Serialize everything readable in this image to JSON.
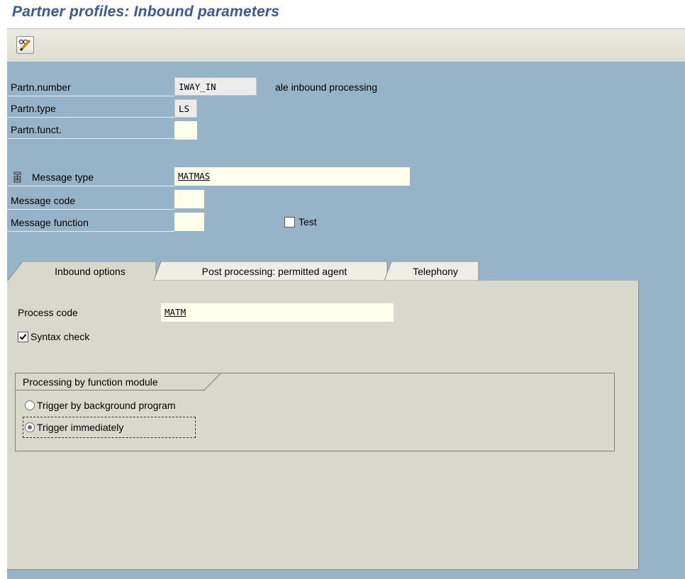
{
  "title": "Partner profiles: Inbound parameters",
  "toolbar": {
    "edit_icon": "display-change-pencil-icon"
  },
  "partner": {
    "number_label": "Partn.number",
    "number_value": "IWAY_IN",
    "number_desc": "ale inbound processing",
    "type_label": "Partn.type",
    "type_value": "LS",
    "funct_label": "Partn.funct.",
    "funct_value": ""
  },
  "message": {
    "icon": "hierarchy-icon",
    "type_label": "Message type",
    "type_value": "MATMAS",
    "code_label": "Message code",
    "code_value": "",
    "function_label": "Message function",
    "function_value": "",
    "test_label": "Test",
    "test_checked": false
  },
  "tabs": [
    {
      "label": "Inbound options",
      "active": true
    },
    {
      "label": "Post processing: permitted agent",
      "active": false
    },
    {
      "label": "Telephony",
      "active": false
    }
  ],
  "inbound": {
    "process_code_label": "Process code",
    "process_code_value": "MATM",
    "syntax_check_label": "Syntax check",
    "syntax_check_checked": true,
    "group_title": "Processing by function module",
    "options": [
      {
        "label": "Trigger by background program",
        "selected": false
      },
      {
        "label": "Trigger immediately",
        "selected": true
      }
    ]
  },
  "colors": {
    "title": "#3a5a94",
    "background": "#97b3c8",
    "panel": "#d9d8cc",
    "input": "#ffffec"
  }
}
